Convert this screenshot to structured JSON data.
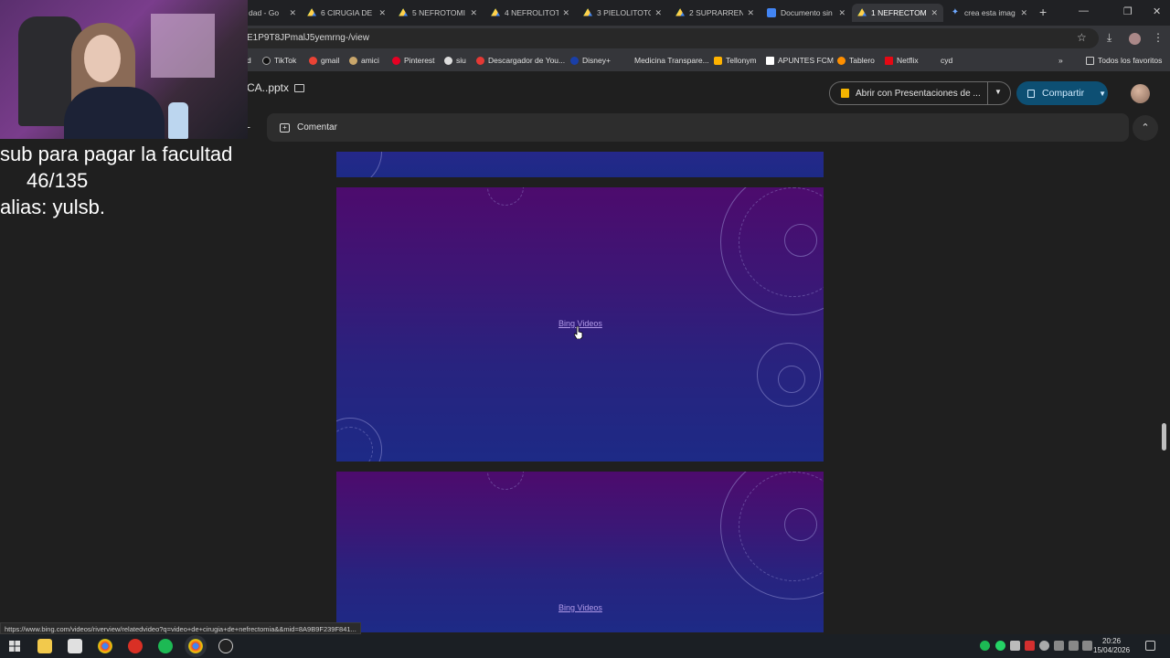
{
  "browser": {
    "tabs": [
      {
        "title": "dad - Go",
        "icon": "drive-icon"
      },
      {
        "title": "6 CIRUGIA DE",
        "icon": "drive-icon"
      },
      {
        "title": "5 NEFROTOMI",
        "icon": "drive-icon"
      },
      {
        "title": "4 NEFROLITOT",
        "icon": "drive-icon"
      },
      {
        "title": "3 PIELOLITOTO",
        "icon": "drive-icon"
      },
      {
        "title": "2 SUPRARREN",
        "icon": "drive-icon"
      },
      {
        "title": "Documento sin",
        "icon": "docs-icon"
      },
      {
        "title": "1 NEFRECTOMI",
        "icon": "drive-icon",
        "active": true
      },
      {
        "title": "crea esta imag",
        "icon": "gemini-icon"
      }
    ],
    "url": "E1P9T8JPmalJ5yemrng-/view",
    "bookmarks": [
      "d",
      "TikTok",
      "gmail",
      "amici",
      "Pinterest",
      "siu",
      "Descargador de You...",
      "Disney+",
      "Medicina Transpare...",
      "Tellonym",
      "APUNTES FCM",
      "Tablero",
      "Netflix",
      "cyd"
    ],
    "all_bookmarks": "Todos los favoritos"
  },
  "drive": {
    "filename": "CA..pptx",
    "open_with": "Abrir con Presentaciones de ...",
    "share": "Compartir",
    "comment": "Comentar"
  },
  "slides": {
    "link_text_1": "Bing Videos",
    "link_text_2": "Bing Videos"
  },
  "stream_overlay": {
    "line1": "sub para pagar la facultad",
    "line2": "46/135",
    "line3": "alias: yulsb."
  },
  "status_url": "https://www.bing.com/videos/riverview/relatedvideo?q=video+de+cirugia+de+nefrectomia&&mid=8A9B9F239F841...",
  "taskbar": {
    "time": "20:26",
    "date": "15/04/2026"
  },
  "colors": {
    "accent_share": "#0d4f73",
    "slide_top": "#4d0b6d",
    "slide_bottom": "#1d2a86",
    "link": "#b19ae8"
  }
}
